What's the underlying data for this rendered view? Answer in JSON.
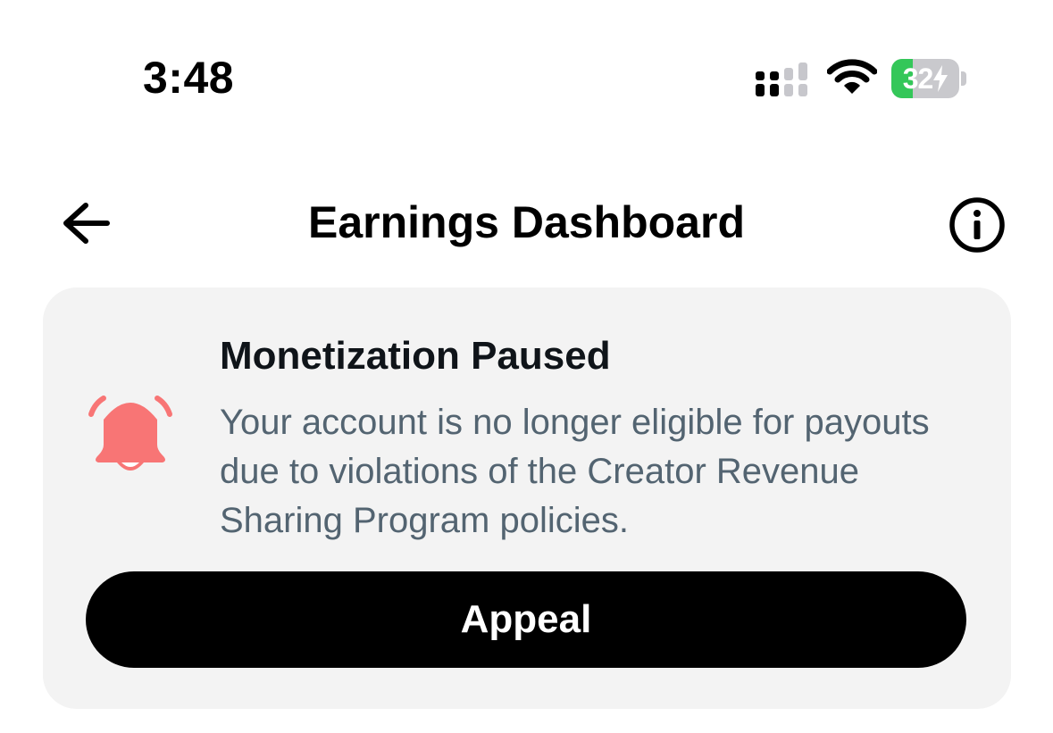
{
  "status_bar": {
    "time": "3:48",
    "battery_percent": "32",
    "battery_level": 0.32,
    "signal_icon": "cellular-signal-icon",
    "wifi_icon": "wifi-icon",
    "battery_color": "#34c759"
  },
  "header": {
    "title": "Earnings Dashboard",
    "back_icon": "arrow-left-icon",
    "info_icon": "info-circle-icon"
  },
  "notice": {
    "icon": "bell-ringing-icon",
    "icon_color": "#f87575",
    "title": "Monetization Paused",
    "body": "Your account is no longer eligible for payouts due to violations of the Creator Revenue Sharing Program policies.",
    "button_label": "Appeal"
  }
}
